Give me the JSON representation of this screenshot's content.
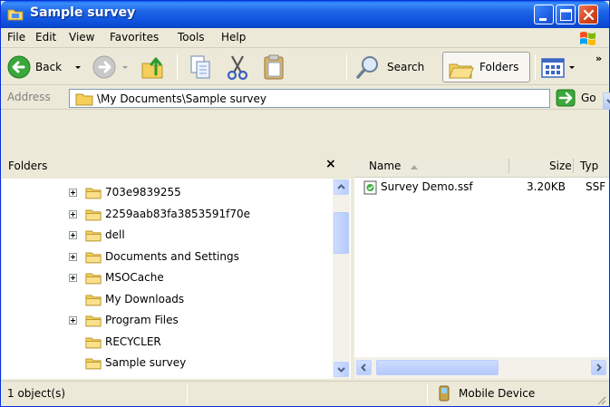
{
  "window": {
    "title": "Sample survey",
    "icon": "folder-window-icon"
  },
  "menu": [
    "File",
    "Edit",
    "View",
    "Favorites",
    "Tools",
    "Help"
  ],
  "toolbar": {
    "back_label": "Back",
    "search_label": "Search",
    "folders_label": "Folders"
  },
  "address": {
    "label": "Address",
    "path": "\\My Documents\\Sample survey",
    "go_label": "Go"
  },
  "folders_pane": {
    "title": "Folders",
    "close_glyph": "×",
    "items": [
      {
        "label": "703e9839255",
        "expandable": true
      },
      {
        "label": "2259aab83fa3853591f70e",
        "expandable": true
      },
      {
        "label": "dell",
        "expandable": true
      },
      {
        "label": "Documents and Settings",
        "expandable": true
      },
      {
        "label": "MSOCache",
        "expandable": true
      },
      {
        "label": "My Downloads",
        "expandable": false
      },
      {
        "label": "Program Files",
        "expandable": true
      },
      {
        "label": "RECYCLER",
        "expandable": false
      },
      {
        "label": "Sample survey",
        "expandable": false
      }
    ]
  },
  "file_list": {
    "columns": [
      "Name",
      "Size",
      "Typ"
    ],
    "rows": [
      {
        "name": "Survey Demo.ssf",
        "size": "3.20KB",
        "type": "SSF"
      }
    ]
  },
  "statusbar": {
    "objects": "1 object(s)",
    "zone": "Mobile Device"
  },
  "colors": {
    "titlebar": "#0a5ce8",
    "frame": "#ece9d8",
    "folder": "#f4cf5a"
  }
}
